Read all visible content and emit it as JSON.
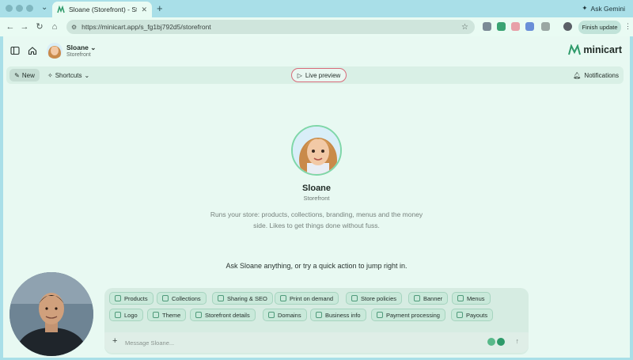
{
  "browser": {
    "tab_title": "Sloane (Storefront) - Stitch",
    "new_tab_symbol": "+",
    "ask_gemini": "Ask Gemini",
    "url": "https://minicart.app/s_fg1bj792d5/storefront",
    "finish_update": "Finish update"
  },
  "app": {
    "agent_name": "Sloane",
    "agent_role": "Storefront",
    "logo_text": "minicart",
    "new_label": "New",
    "shortcuts_label": "Shortcuts",
    "live_preview_label": "Live preview",
    "notifications_label": "Notifications"
  },
  "hero": {
    "name": "Sloane",
    "role": "Storefront",
    "description": "Runs your store: products, collections, branding, menus and the money side. Likes to get things done without fuss.",
    "prompt": "Ask Sloane anything, or try a quick action to jump right in."
  },
  "quick_actions": [
    "Products",
    "Collections",
    "Sharing & SEO",
    "Print on demand",
    "Store policies",
    "Banner",
    "Menus",
    "Logo",
    "Theme",
    "Storefront details",
    "Domains",
    "Business info",
    "Payment processing",
    "Payouts"
  ],
  "composer": {
    "placeholder": "Message Sloane..."
  },
  "colors": {
    "accent": "#7fd7a8",
    "preview_border": "#d86b7a",
    "app_bg": "#e8f9f2",
    "chrome_bg": "#a9dfe8"
  }
}
